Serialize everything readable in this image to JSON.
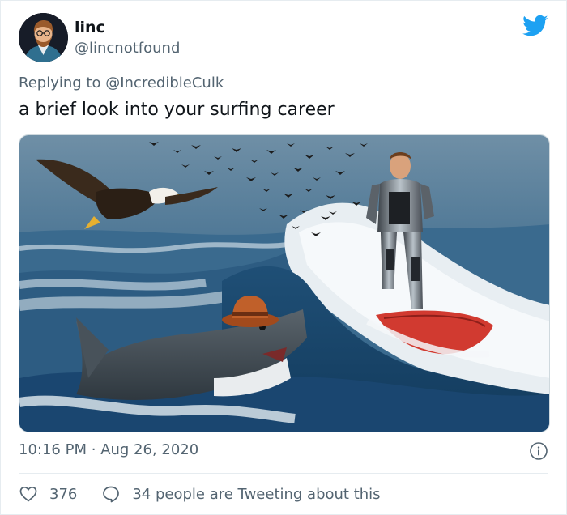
{
  "tweet": {
    "author": {
      "display_name": "linc",
      "handle": "@lincnotfound",
      "avatar": "avatar-illustration"
    },
    "reply": {
      "prefix": "Replying to",
      "mention": "@IncredibleCulk"
    },
    "text": "a brief look into your surfing career",
    "media": {
      "kind": "photo"
    },
    "timestamp": {
      "time": "10:16 PM",
      "separator": "·",
      "date": "Aug 26, 2020"
    },
    "stats": {
      "likes": "376",
      "conversation": "34 people are Tweeting about this"
    }
  },
  "icons": {
    "brand": "twitter-bird-icon",
    "info": "info-icon",
    "like": "heart-icon",
    "reply": "speech-bubble-icon"
  },
  "colors": {
    "twitter_blue": "#1da1f2",
    "muted_text": "#536471",
    "primary_text": "#0f1419"
  }
}
